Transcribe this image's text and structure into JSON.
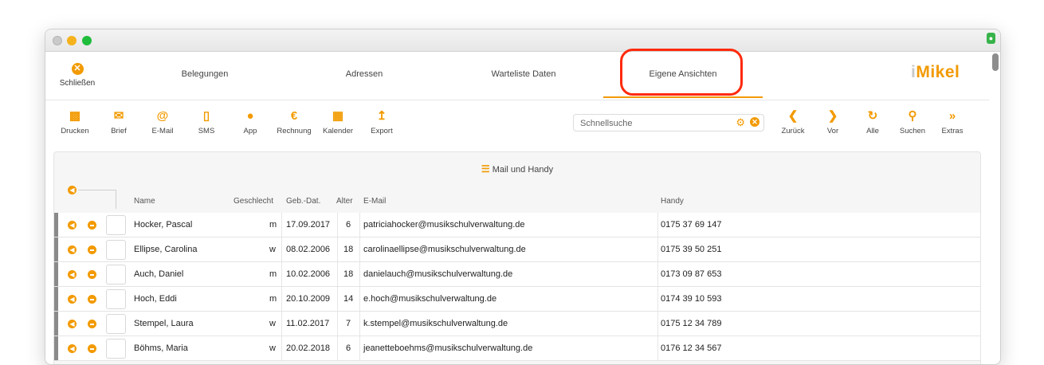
{
  "nav": {
    "close_label": "Schließen",
    "tabs": [
      "Belegungen",
      "Adressen",
      "Warteliste Daten",
      "Eigene Ansichten"
    ],
    "active_tab": "Eigene Ansichten",
    "logo": {
      "prefix": "i",
      "text": "Mikel"
    }
  },
  "toolbar": {
    "left": [
      "Drucken",
      "Brief",
      "E-Mail",
      "SMS",
      "App",
      "Rechnung",
      "Kalender",
      "Export"
    ],
    "search_placeholder": "Schnellsuche",
    "right": [
      "Zurück",
      "Vor",
      "Alle",
      "Suchen",
      "Extras"
    ]
  },
  "view": {
    "title": "Mail und Handy",
    "columns": [
      "Name",
      "Geschlecht",
      "Geb.-Dat.",
      "Alter",
      "E-Mail",
      "Handy"
    ],
    "rows": [
      {
        "name": "Hocker, Pascal",
        "gender": "m",
        "dob": "17.09.2017",
        "age": "6",
        "email": "patriciahocker@musikschulverwaltung.de",
        "mobile": "0175 37 69 147"
      },
      {
        "name": "Ellipse, Carolina",
        "gender": "w",
        "dob": "08.02.2006",
        "age": "18",
        "email": "carolinaellipse@musikschulverwaltung.de",
        "mobile": "0175 39 50 251"
      },
      {
        "name": "Auch, Daniel",
        "gender": "m",
        "dob": "10.02.2006",
        "age": "18",
        "email": "danielauch@musikschulverwaltung.de",
        "mobile": "0173 09 87 653"
      },
      {
        "name": "Hoch, Eddi",
        "gender": "m",
        "dob": "20.10.2009",
        "age": "14",
        "email": "e.hoch@musikschulverwaltung.de",
        "mobile": "0174 39 10 593"
      },
      {
        "name": "Stempel, Laura",
        "gender": "w",
        "dob": "11.02.2017",
        "age": "7",
        "email": "k.stempel@musikschulverwaltung.de",
        "mobile": "0175 12 34 789"
      },
      {
        "name": "Böhms, Maria",
        "gender": "w",
        "dob": "20.02.2018",
        "age": "6",
        "email": "jeanetteboehms@musikschulverwaltung.de",
        "mobile": "0176 12 34 567"
      }
    ]
  },
  "colors": {
    "accent": "#f29a00",
    "highlight": "#ff2a0d"
  }
}
